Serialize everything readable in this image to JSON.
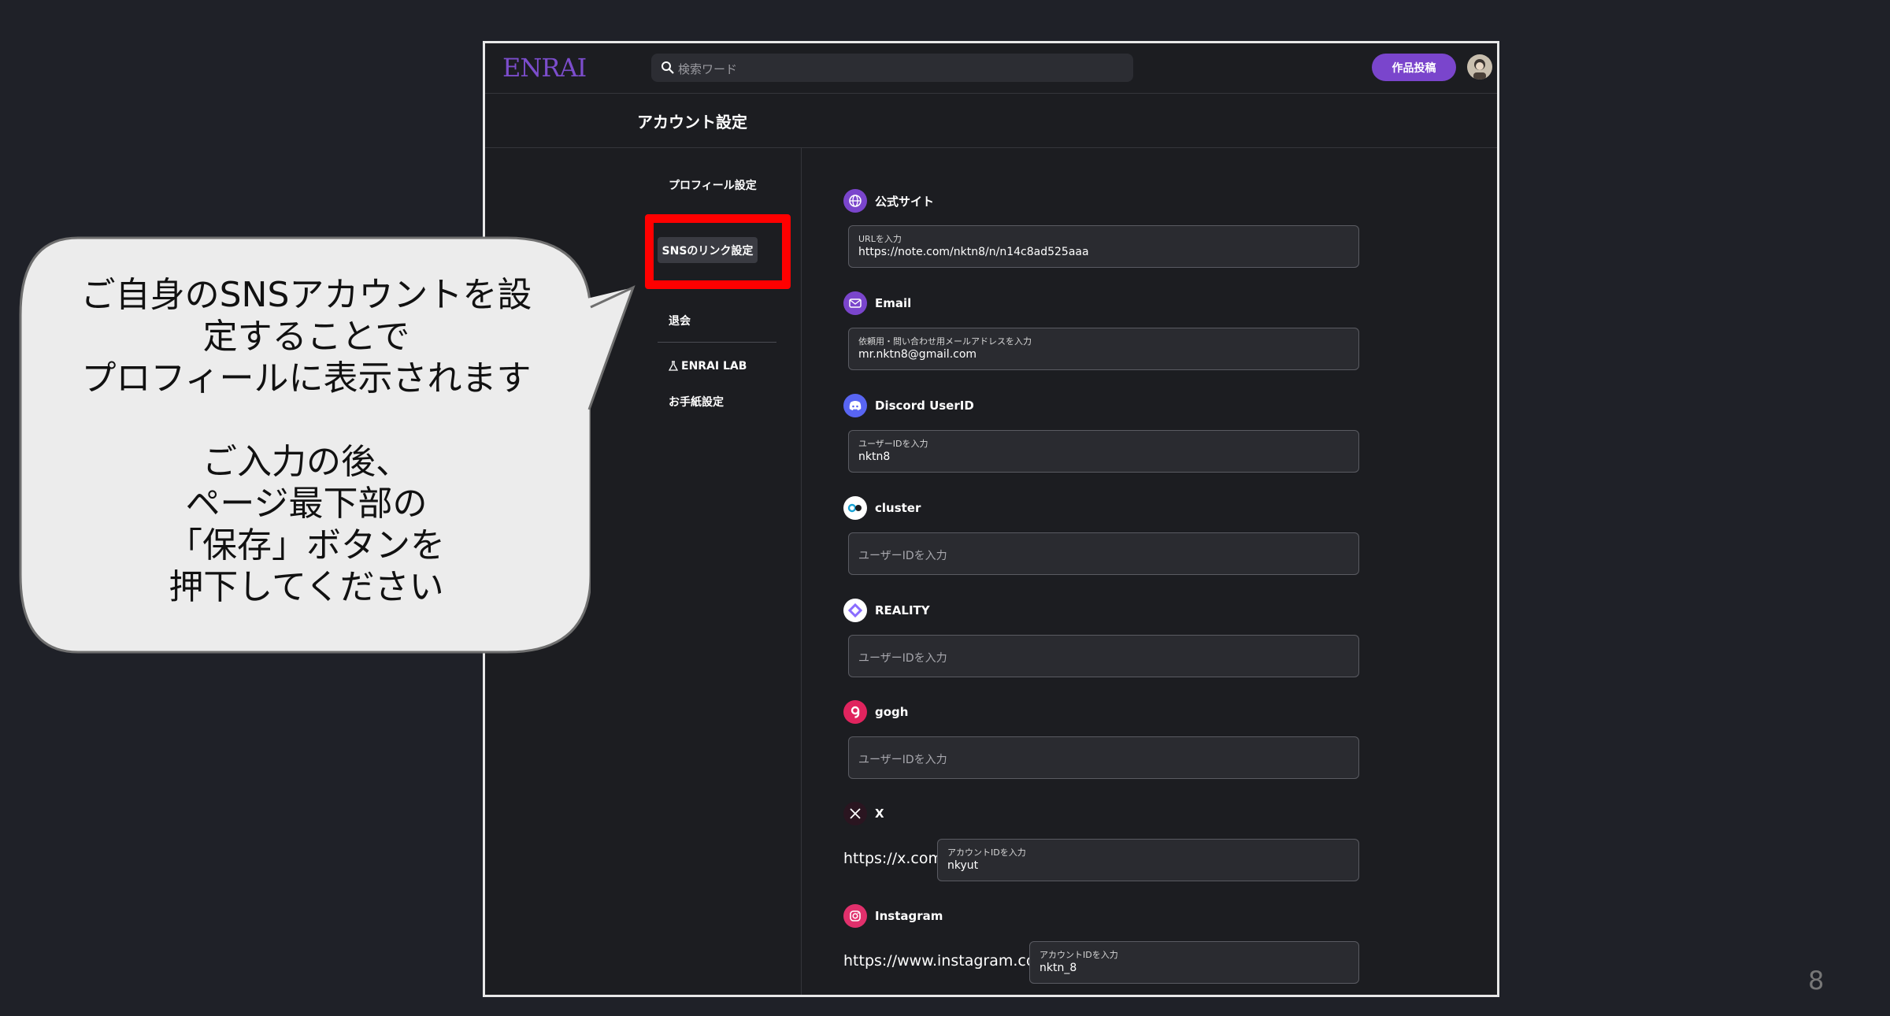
{
  "app": {
    "logo": "ENRAI",
    "search_placeholder": "検索ワード",
    "post_button": "作品投稿"
  },
  "page": {
    "title": "アカウント設定"
  },
  "sidebar": {
    "items": [
      {
        "label": "プロフィール設定"
      },
      {
        "label": "SNSのリンク設定",
        "active": true
      },
      {
        "label": "退会"
      },
      {
        "label": "ENRAI LAB"
      },
      {
        "label": "お手紙設定"
      }
    ]
  },
  "fields": [
    {
      "name": "公式サイト",
      "icon": "globe-icon",
      "color": "#7a45cc",
      "input_label": "URLを入力",
      "value": "https://note.com/nktn8/n/n14c8ad525aaa"
    },
    {
      "name": "Email",
      "icon": "mail-icon",
      "color": "#7a45cc",
      "input_label": "依頼用・問い合わせ用メールアドレスを入力",
      "value": "mr.nktn8@gmail.com"
    },
    {
      "name": "Discord UserID",
      "icon": "discord-icon",
      "color": "#5865f2",
      "input_label": "ユーザーIDを入力",
      "value": "nktn8"
    },
    {
      "name": "cluster",
      "icon": "cluster-icon",
      "color": "#ffffff",
      "placeholder": "ユーザーIDを入力"
    },
    {
      "name": "REALITY",
      "icon": "reality-icon",
      "color": "#ffffff",
      "placeholder": "ユーザーIDを入力"
    },
    {
      "name": "gogh",
      "icon": "gogh-icon",
      "color": "#e0245e",
      "placeholder": "ユーザーIDを入力"
    },
    {
      "name": "X",
      "icon": "x-icon",
      "color": "#2a1520",
      "prefix": "https://x.com/",
      "input_label": "アカウントIDを入力",
      "value": "nkyut"
    },
    {
      "name": "Instagram",
      "icon": "instagram-icon",
      "color": "#e1306c",
      "prefix": "https://www.instagram.com/",
      "input_label": "アカウントIDを入力",
      "value": "nktn_8"
    }
  ],
  "callout": {
    "text": "ご自身のSNSアカウントを設\n定することで\nプロフィールに表示されます\n\nご入力の後、\nページ最下部の\n「保存」ボタンを\n押下してください"
  },
  "slide": {
    "page_number": "8"
  }
}
